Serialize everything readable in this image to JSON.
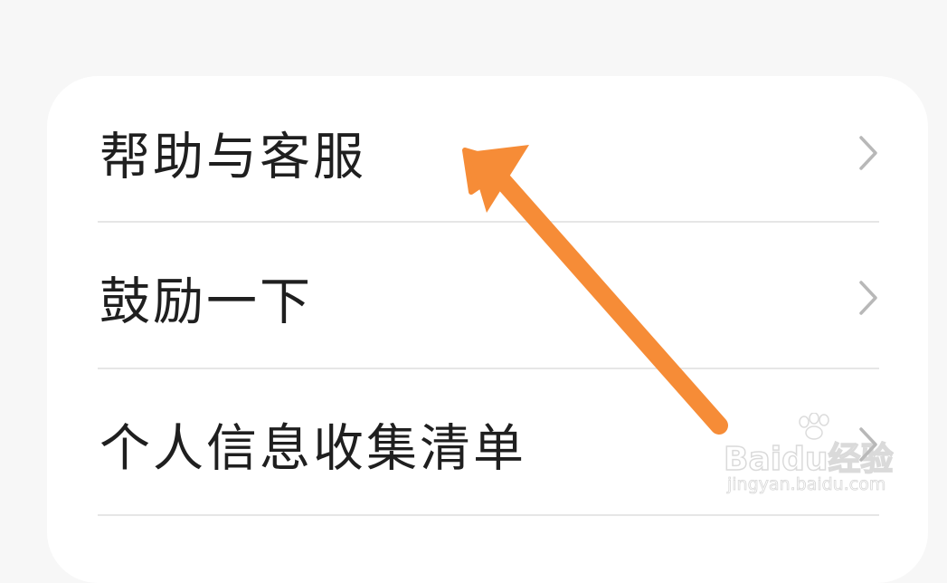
{
  "menu": {
    "items": [
      {
        "label": "帮助与客服",
        "icon": "chevron-right-icon"
      },
      {
        "label": "鼓励一下",
        "icon": "chevron-right-icon"
      },
      {
        "label": "个人信息收集清单",
        "icon": "chevron-right-icon"
      }
    ]
  },
  "annotation": {
    "arrow_color": "#f68c37"
  },
  "watermark": {
    "brand": "Baidu经验",
    "url": "jingyan.baidu.com"
  },
  "colors": {
    "background": "#f7f7f7",
    "card": "#ffffff",
    "text": "#1f1f1f",
    "chevron": "#b8b8b8",
    "divider": "#e6e6e6"
  }
}
